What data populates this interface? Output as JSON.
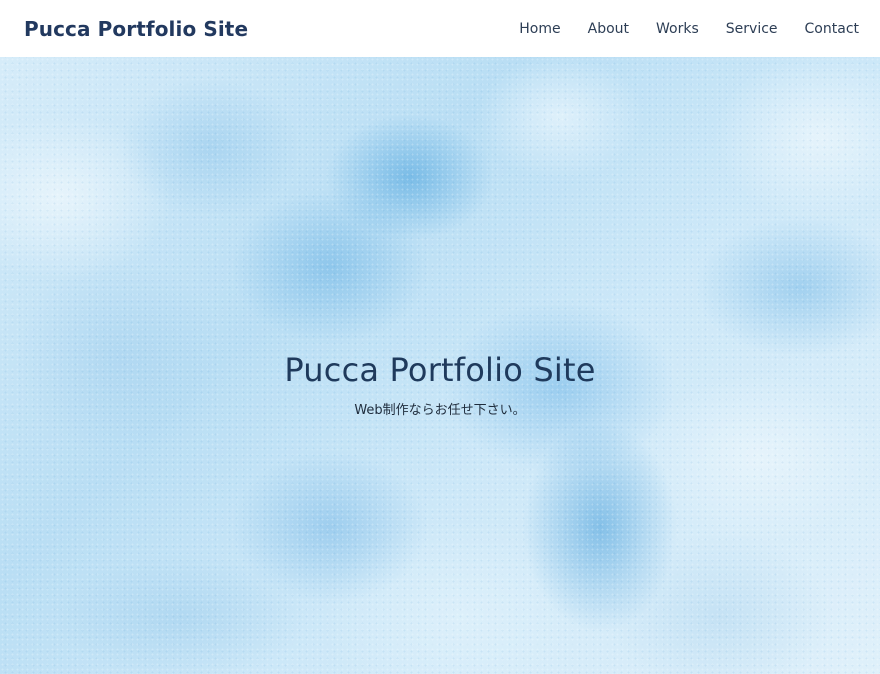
{
  "header": {
    "logo": "Pucca Portfolio Site",
    "nav": [
      {
        "label": "Home"
      },
      {
        "label": "About"
      },
      {
        "label": "Works"
      },
      {
        "label": "Service"
      },
      {
        "label": "Contact"
      }
    ]
  },
  "hero": {
    "title": "Pucca Portfolio Site",
    "subtitle": "Web制作ならお任せ下さい。"
  },
  "colors": {
    "text_primary": "#22395f",
    "hero_background": "#cfe9f8",
    "header_background": "#ffffff"
  }
}
